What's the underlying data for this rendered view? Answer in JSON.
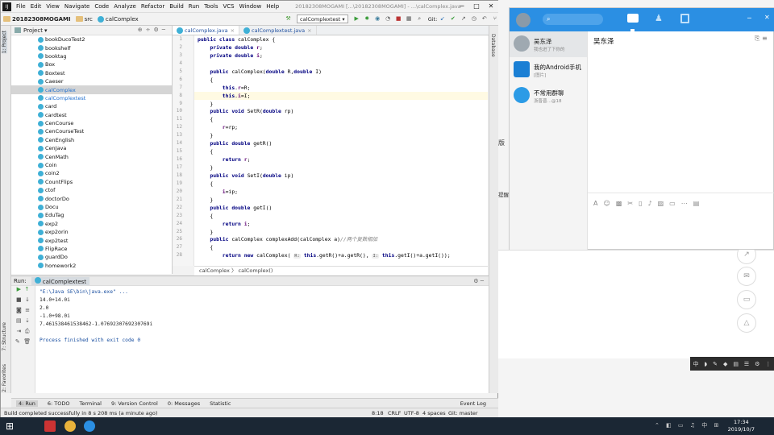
{
  "menubar": {
    "logo": "IJ",
    "items": [
      "File",
      "Edit",
      "View",
      "Navigate",
      "Code",
      "Analyze",
      "Refactor",
      "Build",
      "Run",
      "Tools",
      "VCS",
      "Window",
      "Help"
    ],
    "window_title": "20182308MOGAMI [...\\20182308MOGAMI] - ...\\calComplex.java",
    "minimize": "─",
    "maximize": "□",
    "close": "✕"
  },
  "navbar": {
    "project": "20182308MOGAMI",
    "folder": "src",
    "file": "calComplex",
    "run_config": "calComplextest",
    "git_label": "Git:"
  },
  "left_strip": {
    "project_tab": "1: Project",
    "structure_tab": "7: Structure",
    "favorites_tab": "2: Favorites"
  },
  "right_strip": {
    "database_tab": "Database"
  },
  "project_panel": {
    "title": "Project",
    "items": [
      {
        "label": "bookDucoTest2",
        "state": "normal"
      },
      {
        "label": "bookshelf",
        "state": "normal"
      },
      {
        "label": "booktag",
        "state": "normal"
      },
      {
        "label": "Box",
        "state": "normal"
      },
      {
        "label": "Boxtest",
        "state": "normal"
      },
      {
        "label": "Caeser",
        "state": "normal"
      },
      {
        "label": "calComplex",
        "state": "selected"
      },
      {
        "label": "calComplextest",
        "state": "blue"
      },
      {
        "label": "card",
        "state": "normal"
      },
      {
        "label": "cardtest",
        "state": "normal"
      },
      {
        "label": "CenCourse",
        "state": "normal"
      },
      {
        "label": "CenCourseTest",
        "state": "normal"
      },
      {
        "label": "CenEnglish",
        "state": "normal"
      },
      {
        "label": "CenJava",
        "state": "normal"
      },
      {
        "label": "CenMath",
        "state": "normal"
      },
      {
        "label": "Coin",
        "state": "normal"
      },
      {
        "label": "coin2",
        "state": "normal"
      },
      {
        "label": "CountFlips",
        "state": "normal"
      },
      {
        "label": "ctof",
        "state": "normal"
      },
      {
        "label": "doctorDo",
        "state": "normal"
      },
      {
        "label": "Docu",
        "state": "normal"
      },
      {
        "label": "EduTag",
        "state": "normal"
      },
      {
        "label": "exp2",
        "state": "normal"
      },
      {
        "label": "exp2orin",
        "state": "normal"
      },
      {
        "label": "exp2test",
        "state": "normal"
      },
      {
        "label": "FlipRace",
        "state": "normal"
      },
      {
        "label": "guardDo",
        "state": "normal"
      },
      {
        "label": "homework2",
        "state": "normal"
      }
    ]
  },
  "editor": {
    "tabs": [
      {
        "label": "calComplex.java",
        "active": true
      },
      {
        "label": "calComplextest.java",
        "active": false
      }
    ],
    "close_glyph": "×",
    "line_numbers": [
      "1",
      "2",
      "3",
      "4",
      "5",
      "6",
      "7",
      "8",
      "9",
      "10",
      "11",
      "12",
      "13",
      "14",
      "15",
      "16",
      "17",
      "18",
      "19",
      "20",
      "21",
      "22",
      "23",
      "24",
      "25",
      "26",
      "27",
      "28"
    ],
    "breadcrumb": "calComplex   〉  calComplex()"
  },
  "run_panel": {
    "label": "Run:",
    "config": "calComplextest",
    "output": [
      "\"E:\\Java SE\\bin\\java.exe\" ...",
      "14.0+14.0i",
      "2.0",
      "-1.0+98.0i",
      "7.461538461538462-1.0769230769230769i",
      "",
      "Process finished with exit code 0"
    ]
  },
  "bottom_tabs": [
    "4: Run",
    "6: TODO",
    "Terminal",
    "9: Version Control",
    "0: Messages",
    "Statistic"
  ],
  "event_log": "Event Log",
  "statusbar": {
    "message": "Build completed successfully in 8 s 208 ms (a minute ago)",
    "position": "8:18",
    "line_sep": "CRLF",
    "encoding": "UTF-8",
    "indent": "4 spaces",
    "git": "Git: master"
  },
  "chat": {
    "contacts": [
      {
        "name": "吴东泽",
        "preview": "我也进了下你的",
        "selected": true
      },
      {
        "name": "我的Android手机",
        "preview": "[图片]",
        "selected": false
      },
      {
        "name": "不常用群聊",
        "preview": "浙晋晋…@18",
        "selected": false
      }
    ],
    "conversation_title": "吴东泽"
  },
  "background_text": {
    "ban": "版",
    "hint": "提醒"
  },
  "taskbar": {
    "time": "17:34",
    "date": "2019/10/7"
  },
  "colors": {
    "chat_header": "#2b8fe3",
    "taskbar": "#1b2734",
    "selection": "#d5d5d5",
    "highlight_line": "#fffae3"
  }
}
